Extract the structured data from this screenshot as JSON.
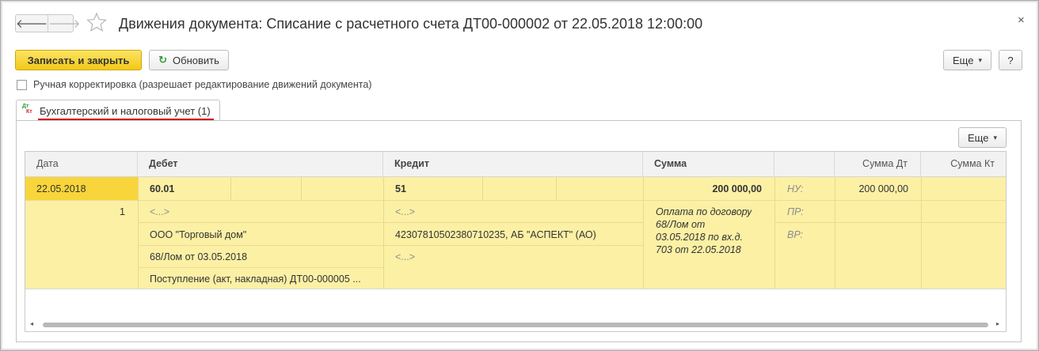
{
  "window": {
    "title": "Движения документа: Списание с расчетного счета ДТ00-000002 от 22.05.2018 12:00:00",
    "close_glyph": "×",
    "back_glyph": "🡐",
    "forward_glyph": "🡒"
  },
  "toolbar": {
    "save_close_label": "Записать и закрыть",
    "refresh_label": "Обновить",
    "refresh_icon": "↻",
    "more_label": "Еще",
    "help_label": "?"
  },
  "manual_edit": {
    "label": "Ручная корректировка (разрешает редактирование движений документа)",
    "checked": false
  },
  "tab": {
    "icon_top": "Дт",
    "icon_bottom": "Кт",
    "label": "Бухгалтерский и налоговый учет (1)"
  },
  "table_toolbar": {
    "more_label": "Еще"
  },
  "table": {
    "columns": {
      "date": "Дата",
      "debit": "Дебет",
      "credit": "Кредит",
      "amount": "Сумма",
      "blank": "",
      "amount_dt": "Сумма Дт",
      "amount_kt": "Сумма Кт"
    },
    "row": {
      "date": "22.05.2018",
      "number": "1",
      "debit_account": "60.01",
      "debit_subconto1": "<...>",
      "debit_subconto2": "ООО \"Торговый дом\"",
      "debit_subconto3": "68/Лом от 03.05.2018",
      "debit_subconto4": "Поступление (акт, накладная) ДТ00-000005 ...",
      "credit_account": "51",
      "credit_subconto1": "<...>",
      "credit_subconto2": "42307810502380710235, АБ \"АСПЕКТ\" (АО)",
      "credit_subconto3": "<...>",
      "amount": "200 000,00",
      "content_line1": "Оплата по договору",
      "content_line2": "68/Лом от",
      "content_line3": "03.05.2018 по вх.д.",
      "content_line4": "703 от 22.05.2018",
      "tax_nu": "НУ:",
      "tax_pr": "ПР:",
      "tax_vr": "ВР:",
      "amount_dt_nu": "200 000,00"
    }
  },
  "scrollbar": {
    "left_arrow": "◂",
    "right_arrow": "▸"
  }
}
